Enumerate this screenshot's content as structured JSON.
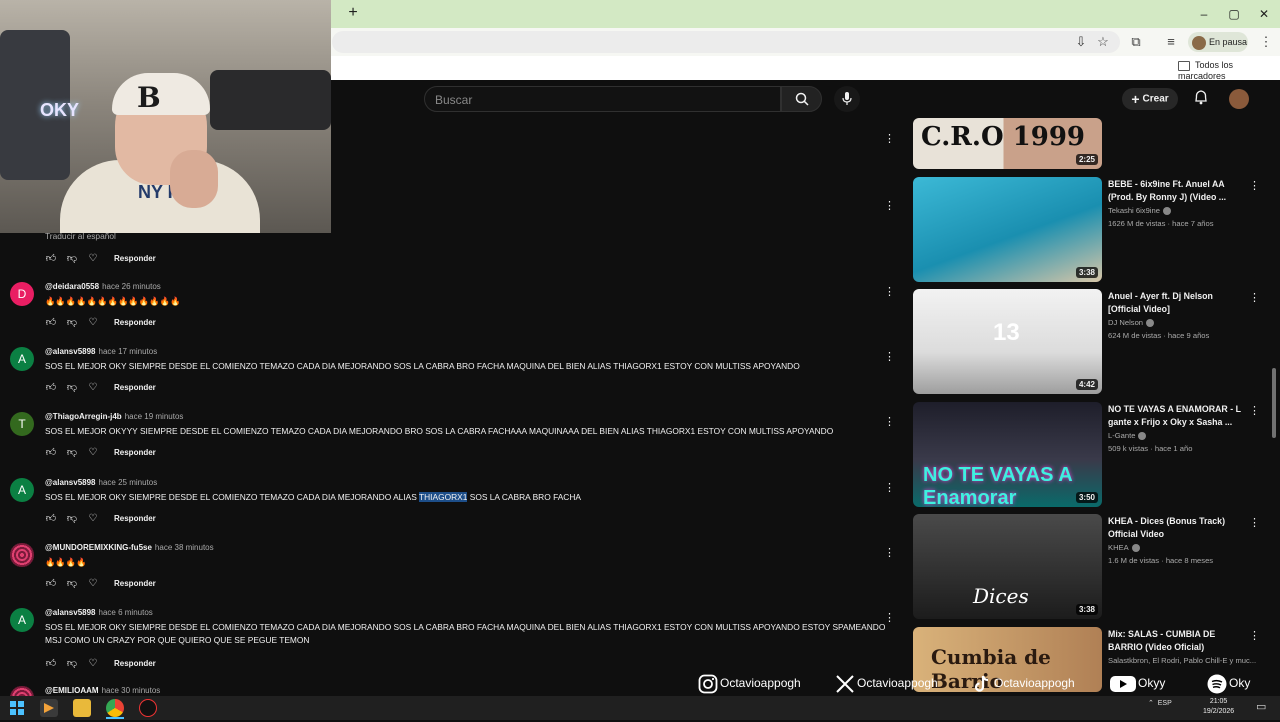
{
  "browser": {
    "new_tab": "+",
    "window_min": "–",
    "window_max": "▢",
    "window_close": "✕",
    "profile_status": "En pausa",
    "bookmarks_all": "Todos los marcadores"
  },
  "webcam": {
    "cap_letter": "B",
    "shirt_text": "NY KEE",
    "neon_sign": "OKY"
  },
  "youtube": {
    "search_placeholder": "Buscar",
    "create_label": "Crear"
  },
  "comments": {
    "translate_link": "Traducir al español",
    "reply_label": "Responder",
    "items": [
      {
        "initial": "D",
        "color": "#e91e63",
        "user": "@deidara0558",
        "ago": "hace 26 minutos",
        "text": "🔥🔥🔥🔥🔥🔥🔥🔥🔥🔥🔥🔥🔥"
      },
      {
        "initial": "A",
        "color": "#0b8043",
        "user": "@alansv5898",
        "ago": "hace 17 minutos",
        "text": "SOS EL MEJOR OKY SIEMPRE DESDE EL COMIENZO TEMAZO CADA DIA  MEJORANDO   SOS LA CABRA BRO FACHA MAQUINA DEL BIEN     ALIAS THIAGORX1   ESTOY CON MULTISS APOYANDO"
      },
      {
        "initial": "T",
        "color": "#33691e",
        "user": "@ThiagoArregin-j4b",
        "ago": "hace 19 minutos",
        "text": "SOS EL MEJOR OKYYY SIEMPRE DESDE EL COMIENZO TEMAZO CADA DIA MEJORANDO BRO SOS LA CABRA FACHAAA MAQUINAAA DEL BIEN ALIAS THIAGORX1     ESTOY CON MULTISS APOYANDO"
      },
      {
        "initial": "A",
        "color": "#0b8043",
        "user": "@alansv5898",
        "ago": "hace 25 minutos",
        "text_before": "SOS EL MEJOR OKY SIEMPRE DESDE EL COMIENZO TEMAZO CADA DIA  MEJORANDO ALIAS ",
        "text_highlight": "THIAGORX1",
        "text_after": "  SOS LA CABRA BRO FACHA"
      },
      {
        "initial": "",
        "color": "#c2185b",
        "user": "@MUNDOREMIXKING-fu5se",
        "ago": "hace 38 minutos",
        "text": "🔥🔥🔥🔥"
      },
      {
        "initial": "A",
        "color": "#0b8043",
        "user": "@alansv5898",
        "ago": "hace 6 minutos",
        "text": "SOS EL MEJOR OKY SIEMPRE DESDE EL COMIENZO TEMAZO CADA DIA  MEJORANDO   SOS LA CABRA BRO FACHA MAQUINA DEL BIEN     ALIAS THIAGORX1   ESTOY CON MULTISS APOYANDO    ESTOY SPAMEANDO MSJ COMO UN CRAZY POR QUE QUIERO QUE SE PEGUE TEMON"
      },
      {
        "initial": "",
        "color": "#5d4037",
        "user": "@EMILIOAAM",
        "ago": "hace 30 minutos",
        "text": ""
      }
    ]
  },
  "related": [
    {
      "title": "",
      "channel": "",
      "meta": "",
      "duration": "2:25",
      "thumb_text": "C.R.O 1999"
    },
    {
      "title": "BEBE - 6ix9ine Ft. Anuel AA (Prod. By Ronny J) (Video ...",
      "channel": "Tekashi 6ix9ine",
      "meta": "1626 M de vistas · hace 7 años",
      "duration": "3:38",
      "thumb_text": ""
    },
    {
      "title": "Anuel - Ayer ft. Dj Nelson [Official Video]",
      "channel": "DJ Nelson",
      "meta": "624 M de vistas · hace 9 años",
      "duration": "4:42",
      "thumb_text": "13"
    },
    {
      "title": "NO TE VAYAS A ENAMORAR - L gante x Frijo x Oky x Sasha ...",
      "channel": "L-Gante",
      "meta": "509 k vistas · hace 1 año",
      "duration": "3:50",
      "thumb_text": "NO TE VAYAS A Enamorar"
    },
    {
      "title": "KHEA - Dices (Bonus Track) Official Video",
      "channel": "KHEA",
      "meta": "1.6 M de vistas · hace 8 meses",
      "duration": "3:38",
      "thumb_text": "Dices"
    },
    {
      "title": "Mix: SALAS - CUMBIA DE BARRIO (Video Oficial)",
      "channel": "Salastkbron, El Rodri, Pablo Chill-E y muc...",
      "meta": "",
      "duration": "",
      "thumb_text": "Cumbia de Barrio"
    }
  ],
  "socials": [
    {
      "icon": "instagram-icon",
      "handle": "Octavioappogh"
    },
    {
      "icon": "x-icon",
      "handle": "Octavioappogh"
    },
    {
      "icon": "tiktok-icon",
      "handle": "Octavioappogh"
    },
    {
      "icon": "youtube-icon",
      "handle": "Okyy"
    },
    {
      "icon": "spotify-icon",
      "handle": "Oky"
    }
  ],
  "taskbar": {
    "lang": "ESP",
    "time": "21:05",
    "date": "19/2/2026"
  }
}
